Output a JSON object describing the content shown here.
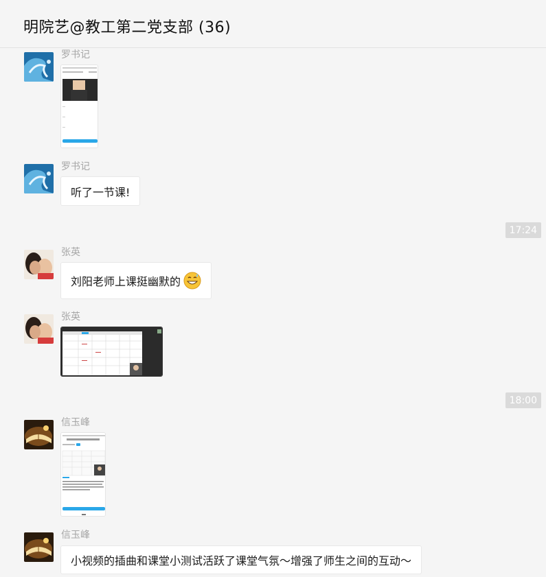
{
  "header": {
    "title": "明院艺@教工第二党支部 (36)"
  },
  "messages": [
    {
      "sender": "罗书记",
      "type": "image"
    },
    {
      "sender": "罗书记",
      "type": "text",
      "text": "听了一节课!"
    },
    {
      "time": "17:24"
    },
    {
      "sender": "张英",
      "type": "text",
      "text": "刘阳老师上课挺幽默的",
      "emoji": "grin-sweat-emoji"
    },
    {
      "sender": "张英",
      "type": "image"
    },
    {
      "time": "18:00"
    },
    {
      "sender": "信玉峰",
      "type": "image"
    },
    {
      "sender": "信玉峰",
      "type": "text",
      "text": "小视频的插曲和课堂小测试活跃了课堂气氛～增强了师生之间的互动～"
    }
  ],
  "colors": {
    "background": "#f5f5f5",
    "bubble": "#ffffff",
    "time_badge": "#dadada",
    "sender": "#a6a6a6"
  }
}
